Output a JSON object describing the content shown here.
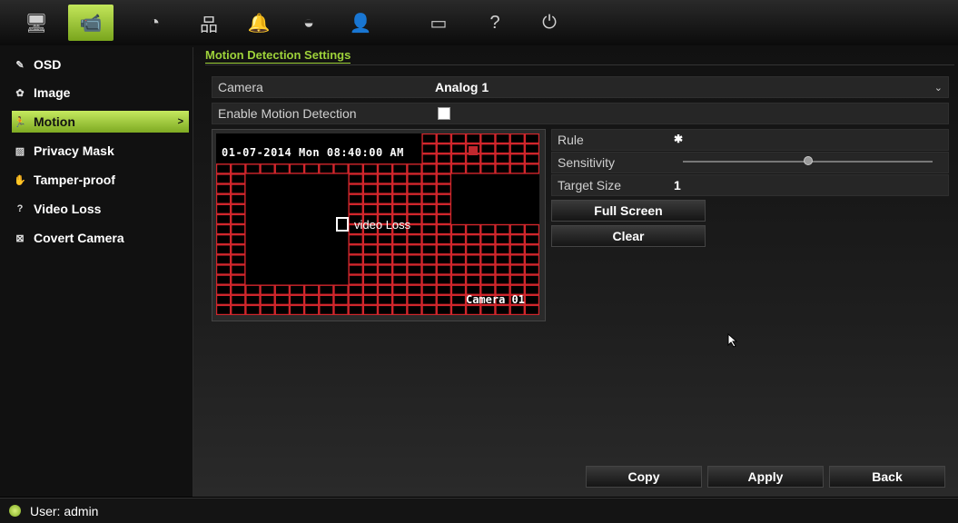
{
  "toolbar": {
    "icons": [
      "display-icon",
      "camera-icon",
      "gauge-icon",
      "network-icon",
      "alarm-bell-icon",
      "dome-camera-icon",
      "user-icon",
      "hdd-icon",
      "help-icon",
      "power-icon"
    ],
    "glyphs": [
      "🖥",
      "📹",
      "◔",
      "品",
      "🔔",
      "◒",
      "👤",
      "▭",
      "?",
      "⏻"
    ],
    "active_index": 1
  },
  "sidebar": {
    "items": [
      {
        "label": "OSD",
        "icon": "osd-icon",
        "glyph": "✎"
      },
      {
        "label": "Image",
        "icon": "image-icon",
        "glyph": "✿"
      },
      {
        "label": "Motion",
        "icon": "motion-icon",
        "glyph": "🏃"
      },
      {
        "label": "Privacy Mask",
        "icon": "privacy-mask-icon",
        "glyph": "▨"
      },
      {
        "label": "Tamper-proof",
        "icon": "tamper-hand-icon",
        "glyph": "✋"
      },
      {
        "label": "Video Loss",
        "icon": "video-loss-icon",
        "glyph": "?"
      },
      {
        "label": "Covert Camera",
        "icon": "covert-camera-icon",
        "glyph": "⊠"
      }
    ],
    "active_index": 2,
    "active_arrow": ">"
  },
  "page": {
    "title": "Motion Detection Settings"
  },
  "form": {
    "camera_label": "Camera",
    "camera_value": "Analog 1",
    "enable_label": "Enable Motion Detection",
    "enable_checked": true
  },
  "preview": {
    "timestamp": "01-07-2014 Mon 08:40:00 AM",
    "camera_name": "Camera 01",
    "video_loss_text": "video Loss"
  },
  "params": {
    "rule_label": "Rule",
    "sensitivity_label": "Sensitivity",
    "sensitivity_value": 0.5,
    "target_size_label": "Target Size",
    "target_size_value": "1"
  },
  "buttons": {
    "full_screen": "Full Screen",
    "clear": "Clear",
    "copy": "Copy",
    "apply": "Apply",
    "back": "Back"
  },
  "status": {
    "user_text": "User: admin"
  },
  "colors": {
    "accent": "#9ed23a",
    "grid_red": "#d0262c"
  }
}
